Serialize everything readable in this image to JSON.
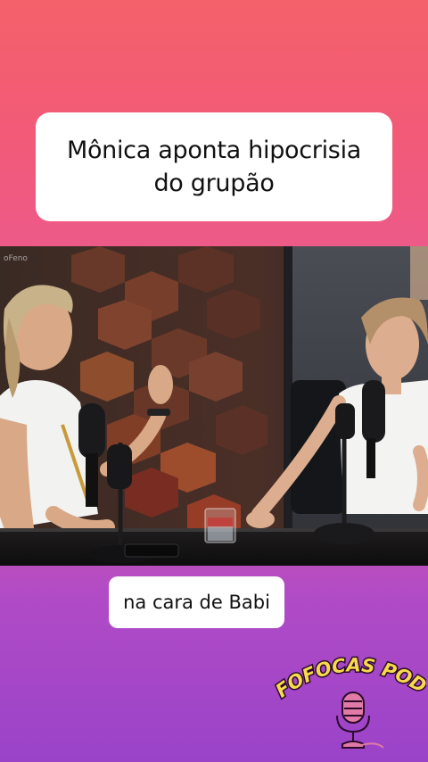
{
  "title": {
    "line1": "Mônica aponta hipocrisia",
    "line2": "do grupão"
  },
  "video": {
    "watermark": "oFeno"
  },
  "caption": {
    "text": "na cara de Babi"
  },
  "logo": {
    "text": "FOFOCAS PODS",
    "icon": "microphone-icon"
  },
  "colors": {
    "gradient_top": "#f4616a",
    "gradient_bottom": "#9a43c9",
    "card_bg": "#ffffff",
    "logo_text": "#f7d94c"
  }
}
